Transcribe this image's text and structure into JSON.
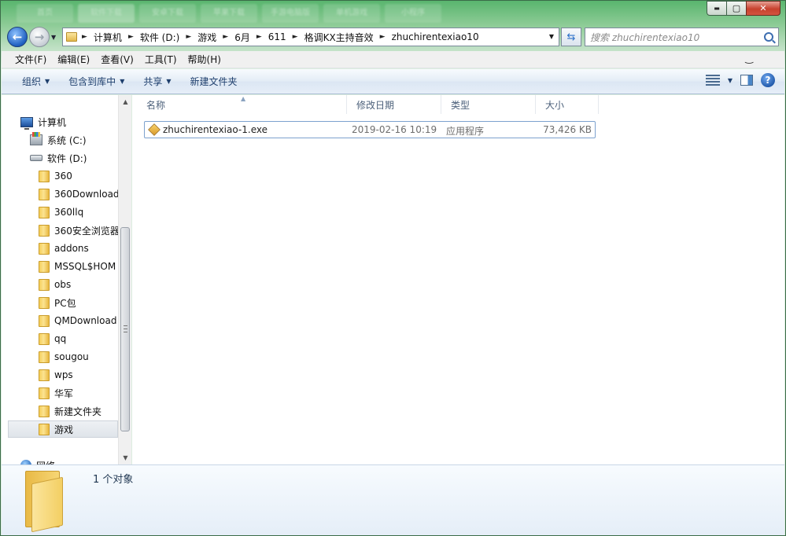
{
  "window": {
    "bg_tabs": [
      "首页",
      "软件下载",
      "安卓下载",
      "苹果下载",
      "手游电脑版",
      "单机游戏",
      "小程序"
    ],
    "caption": {
      "minimize": "▬",
      "maximize": "▢",
      "close": "✕"
    }
  },
  "address": {
    "crumbs": [
      "计算机",
      "软件 (D:)",
      "游戏",
      "6月",
      "611",
      "格调KX主持音效",
      "zhuchirentexiao10"
    ],
    "search_placeholder": "搜索 zhuchirentexiao10"
  },
  "menubar": {
    "items": [
      "文件(F)",
      "编辑(E)",
      "查看(V)",
      "工具(T)",
      "帮助(H)"
    ],
    "ctl": "‿"
  },
  "cmdbar": {
    "organize": "组织",
    "include": "包含到库中",
    "share": "共享",
    "new_folder": "新建文件夹"
  },
  "nav": {
    "computer": "计算机",
    "drive_c": "系统 (C:)",
    "drive_d": "软件 (D:)",
    "folders": [
      "360",
      "360Download",
      "360llq",
      "360安全浏览器",
      "addons",
      "MSSQL$HOM",
      "obs",
      "PC包",
      "QMDownload",
      "qq",
      "sougou",
      "wps",
      "华军",
      "新建文件夹",
      "游戏"
    ],
    "network": "网络"
  },
  "columns": {
    "name": "名称",
    "date": "修改日期",
    "type": "类型",
    "size": "大小"
  },
  "files": [
    {
      "name": "zhuchirentexiao-1.exe",
      "date": "2019-02-16 10:19",
      "type": "应用程序",
      "size": "73,426 KB"
    }
  ],
  "details": {
    "count": "1 个对象"
  },
  "colors": {
    "accent": "#1f5fc0",
    "selection_border": "#7da2ce",
    "header_text": "#4c607a"
  }
}
